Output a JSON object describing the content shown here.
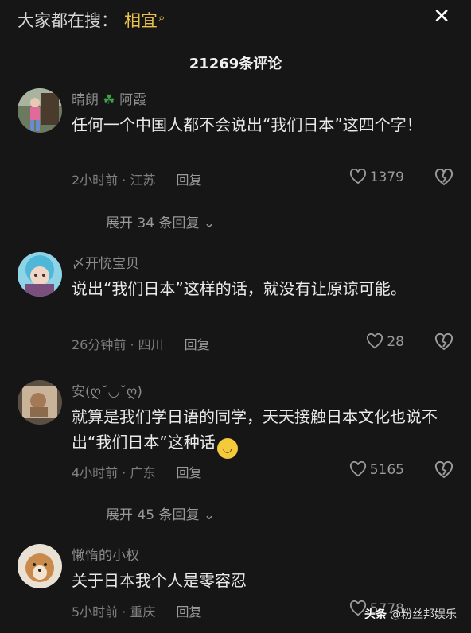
{
  "search": {
    "prefix": "大家都在搜：",
    "term": "相宜",
    "icon": "search-icon"
  },
  "header": {
    "title": "21269条评论",
    "close_icon": "close-icon"
  },
  "comments": [
    {
      "author": "晴朗",
      "author_suffix": "阿霞",
      "text": "任何一个中国人都不会说出“我们日本”这四个字！",
      "time": "2小时前 · 江苏",
      "reply": "回复",
      "likes": "1379",
      "expand": "展开 34 条回复"
    },
    {
      "author": "〆开㤝宝贝",
      "text": "说出“我们日本”这样的话，就没有让原谅可能。",
      "time": "26分钟前 · 四川",
      "reply": "回复",
      "likes": "28"
    },
    {
      "author": "安(ღ˘◡˘ღ)",
      "text": "就算是我们学日语的同学，天天接触日本文化也说不出“我们日本”这种话",
      "time": "4小时前 · 广东",
      "reply": "回复",
      "likes": "5165",
      "expand": "展开 45 条回复"
    },
    {
      "author": "懒惰的小权",
      "text": "关于日本我个人是零容忍",
      "time": "5小时前 · 重庆",
      "reply": "回复",
      "likes": "5778"
    }
  ],
  "watermark": {
    "logo": "头条",
    "handle": "@粉丝邦娱乐"
  }
}
